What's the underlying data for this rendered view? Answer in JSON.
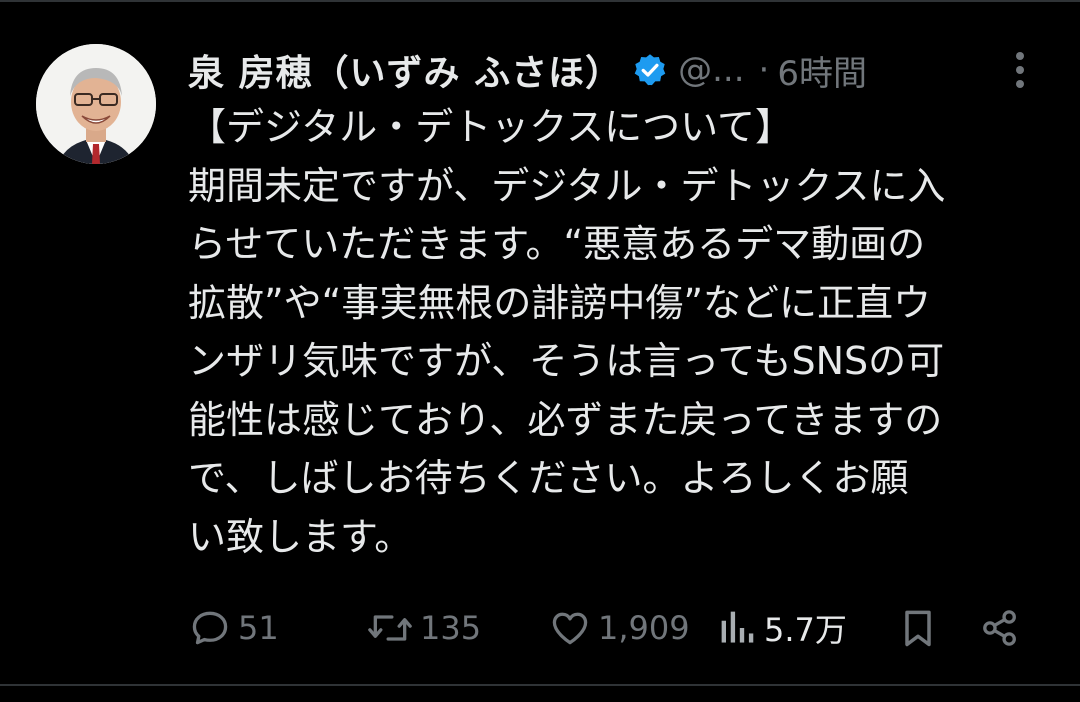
{
  "post": {
    "author": {
      "display_name": "泉 房穂（いずみ ふさほ）",
      "handle": "@...",
      "verified": true,
      "avatar_icon": "profile-photo"
    },
    "time_separator": "·",
    "timestamp": "6時間",
    "text_lines": [
      "【デジタル・デトックスについて】",
      "期間未定ですが、デジタル・デトックスに入",
      "らせていただきます。“悪意あるデマ動画の",
      "拡散”や“事実無根の誹謗中傷”などに正直ウ",
      "ンザリ気味ですが、そうは言ってもSNSの可",
      "能性は感じており、必ずまた戻ってきますの",
      "で、しばしお待ちください。よろしくお願",
      "い致します。"
    ],
    "actions": {
      "replies": "51",
      "reposts": "135",
      "likes": "1,909",
      "views": "5.7万"
    }
  },
  "colors": {
    "background": "#000000",
    "text": "#e7e9ea",
    "muted": "#71767b",
    "verified_badge": "#1d9bf0",
    "divider": "#2f3336"
  },
  "icons": {
    "verified": "verified-badge-icon",
    "more": "more-vertical-icon",
    "reply": "comment-icon",
    "repost": "repost-icon",
    "like": "heart-icon",
    "views": "bar-chart-icon",
    "bookmark": "bookmark-icon",
    "share": "share-icon"
  }
}
